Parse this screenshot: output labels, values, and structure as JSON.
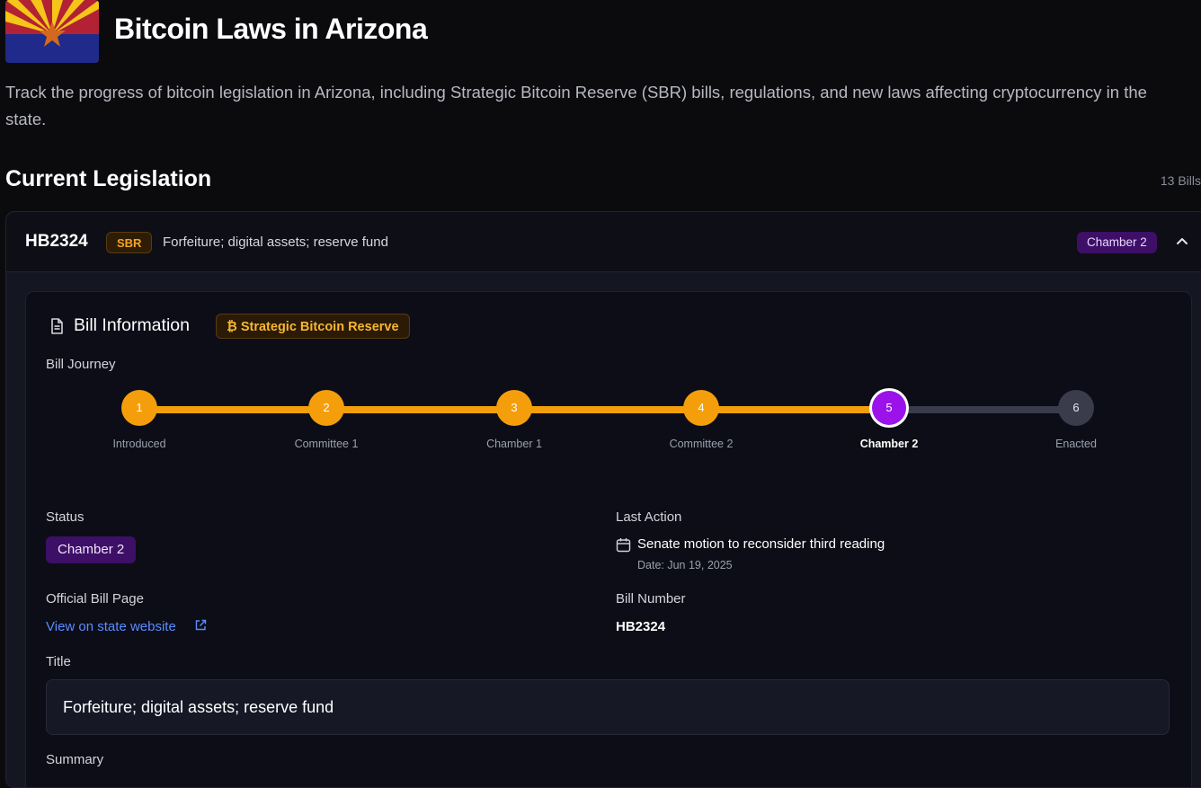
{
  "page": {
    "title": "Bitcoin Laws in Arizona",
    "description": "Track the progress of bitcoin legislation in Arizona, including Strategic Bitcoin Reserve (SBR) bills, regulations, and new laws affecting cryptocurrency in the state."
  },
  "section": {
    "title": "Current Legislation",
    "count": "13 Bills"
  },
  "bill": {
    "id": "HB2324",
    "tag": "SBR",
    "name": "Forfeiture; digital assets; reserve fund",
    "status_badge": "Chamber 2",
    "info_title": "Bill Information",
    "reserve_tag": "₿ Strategic Bitcoin Reserve",
    "journey_label": "Bill Journey",
    "steps": [
      {
        "num": "1",
        "label": "Introduced",
        "state": "done"
      },
      {
        "num": "2",
        "label": "Committee 1",
        "state": "done"
      },
      {
        "num": "3",
        "label": "Chamber 1",
        "state": "done"
      },
      {
        "num": "4",
        "label": "Committee 2",
        "state": "done"
      },
      {
        "num": "5",
        "label": "Chamber 2",
        "state": "current"
      },
      {
        "num": "6",
        "label": "Enacted",
        "state": "todo"
      }
    ],
    "status_label": "Status",
    "status_value": "Chamber 2",
    "last_action_label": "Last Action",
    "last_action": "Senate motion to reconsider third reading",
    "last_action_date": "Date: Jun 19, 2025",
    "official_label": "Official Bill Page",
    "official_link": "View on state website",
    "bill_number_label": "Bill Number",
    "bill_number": "HB2324",
    "title_label": "Title",
    "title_value": "Forfeiture; digital assets; reserve fund",
    "summary_label": "Summary"
  },
  "colors": {
    "done": "#f59e0b",
    "current": "#9b12ea",
    "todo": "#3a3c4c",
    "link": "#5b8cff"
  }
}
